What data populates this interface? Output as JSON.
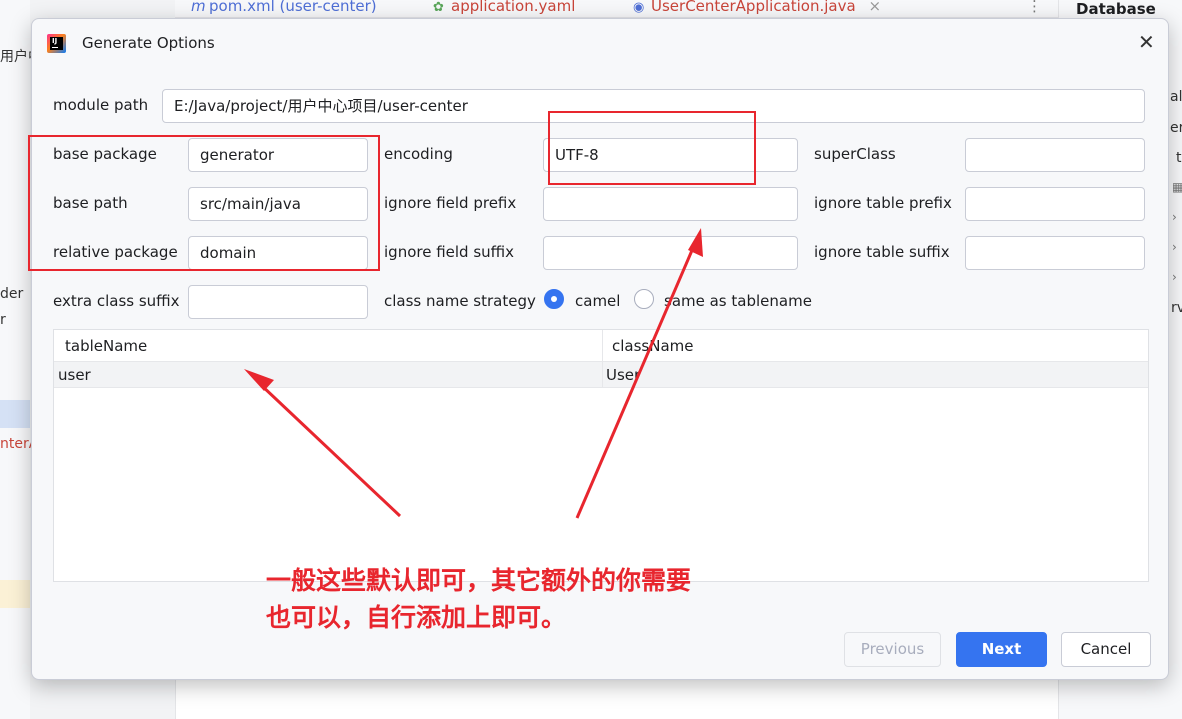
{
  "ide": {
    "tabs": [
      {
        "icon": "m",
        "label": "pom.xml (user-center)",
        "color": "#4f6fd6"
      },
      {
        "icon": "yaml",
        "label": "application.yaml",
        "color": "#c9453a"
      },
      {
        "icon": "java",
        "label": "UserCenterApplication.java",
        "color": "#c9453a"
      }
    ],
    "tab_close": "×",
    "tab_more": "⋮",
    "left_fragments": [
      "用户中",
      "der",
      "r",
      "nterA"
    ],
    "right_panel_title": "Database",
    "right_fragments": [
      "alh",
      "er",
      "t",
      "rv"
    ]
  },
  "dialog": {
    "title": "Generate Options",
    "close_symbol": "✕",
    "module_path": {
      "label": "module path",
      "value": "E:/Java/project/用户中心项目/user-center"
    },
    "base_package": {
      "label": "base package",
      "value": "generator"
    },
    "base_path": {
      "label": "base path",
      "value": "src/main/java"
    },
    "relative_package": {
      "label": "relative package",
      "value": "domain"
    },
    "extra_class_suffix": {
      "label": "extra class suffix",
      "value": ""
    },
    "encoding": {
      "label": "encoding",
      "value": "UTF-8"
    },
    "ignore_field_prefix": {
      "label": "ignore field prefix",
      "value": ""
    },
    "ignore_field_suffix": {
      "label": "ignore field suffix",
      "value": ""
    },
    "super_class": {
      "label": "superClass",
      "value": ""
    },
    "ignore_table_prefix": {
      "label": "ignore table prefix",
      "value": ""
    },
    "ignore_table_suffix": {
      "label": "ignore table suffix",
      "value": ""
    },
    "class_name_strategy": {
      "label": "class name strategy",
      "options": [
        {
          "label": "camel",
          "selected": true
        },
        {
          "label": "same as tablename",
          "selected": false
        }
      ]
    },
    "table": {
      "headers": [
        "tableName",
        "className"
      ],
      "rows": [
        [
          "user",
          "User"
        ]
      ]
    },
    "buttons": {
      "previous": "Previous",
      "next": "Next",
      "cancel": "Cancel"
    }
  },
  "annotation": {
    "line1": "一般这些默认即可，其它额外的你需要",
    "line2": "也可以，自行添加上即可。",
    "color": "#e8262e"
  }
}
